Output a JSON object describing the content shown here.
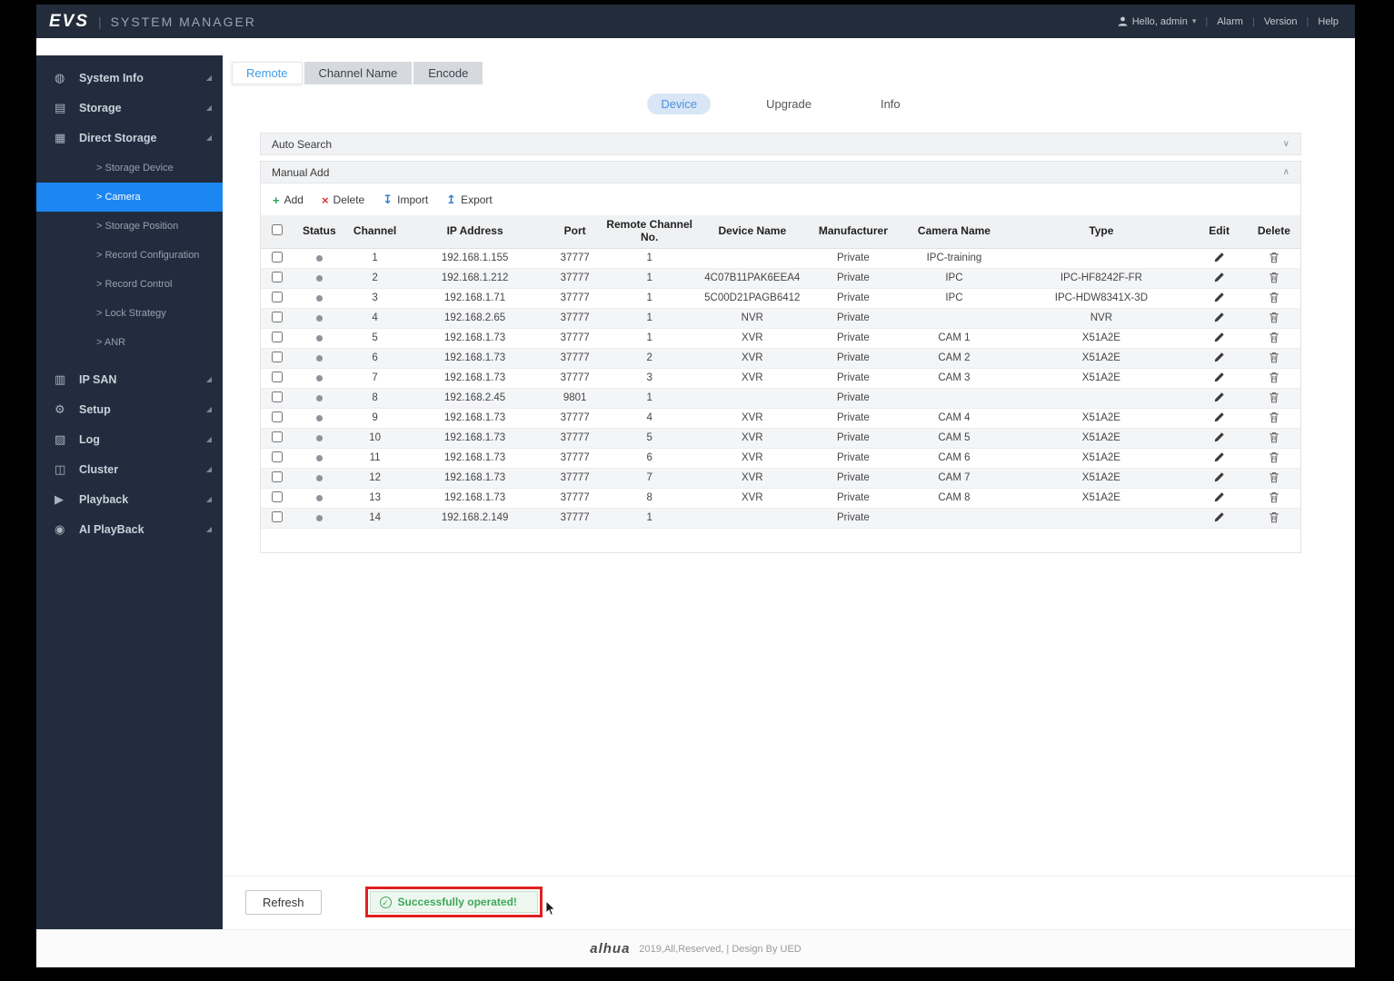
{
  "header": {
    "logo": "EVS",
    "title": "SYSTEM MANAGER",
    "user": "Hello, admin",
    "links": [
      "Alarm",
      "Version",
      "Help"
    ]
  },
  "sidebar": {
    "items": [
      {
        "label": "System Info",
        "icon": "system-info"
      },
      {
        "label": "Storage",
        "icon": "storage"
      },
      {
        "label": "Direct Storage",
        "icon": "direct-storage",
        "expanded": true,
        "children": [
          "Storage Device",
          "Camera",
          "Storage Position",
          "Record Configuration",
          "Record Control",
          "Lock Strategy",
          "ANR"
        ],
        "active_child": "Camera"
      },
      {
        "label": "IP SAN",
        "icon": "ip-san"
      },
      {
        "label": "Setup",
        "icon": "setup"
      },
      {
        "label": "Log",
        "icon": "log"
      },
      {
        "label": "Cluster",
        "icon": "cluster"
      },
      {
        "label": "Playback",
        "icon": "playback"
      },
      {
        "label": "AI PlayBack",
        "icon": "ai-playback"
      }
    ]
  },
  "tabs": {
    "items": [
      "Remote",
      "Channel Name",
      "Encode"
    ],
    "active": "Remote"
  },
  "subtabs": {
    "items": [
      "Device",
      "Upgrade",
      "Info"
    ],
    "active": "Device"
  },
  "sections": {
    "auto_search": "Auto Search",
    "manual_add": "Manual Add"
  },
  "toolbar": {
    "add": "Add",
    "delete": "Delete",
    "import": "Import",
    "export": "Export"
  },
  "table": {
    "columns": [
      "",
      "Status",
      "Channel",
      "IP Address",
      "Port",
      "Remote Channel No.",
      "Device Name",
      "Manufacturer",
      "Camera Name",
      "Type",
      "Edit",
      "Delete"
    ],
    "rows": [
      {
        "channel": "1",
        "ip": "192.168.1.155",
        "port": "37777",
        "remote_channel_no": "1",
        "device_name": "",
        "manufacturer": "Private",
        "camera_name": "IPC-training",
        "type": ""
      },
      {
        "channel": "2",
        "ip": "192.168.1.212",
        "port": "37777",
        "remote_channel_no": "1",
        "device_name": "4C07B11PAK6EEA4",
        "manufacturer": "Private",
        "camera_name": "IPC",
        "type": "IPC-HF8242F-FR"
      },
      {
        "channel": "3",
        "ip": "192.168.1.71",
        "port": "37777",
        "remote_channel_no": "1",
        "device_name": "5C00D21PAGB6412",
        "manufacturer": "Private",
        "camera_name": "IPC",
        "type": "IPC-HDW8341X-3D"
      },
      {
        "channel": "4",
        "ip": "192.168.2.65",
        "port": "37777",
        "remote_channel_no": "1",
        "device_name": "NVR",
        "manufacturer": "Private",
        "camera_name": "",
        "type": "NVR"
      },
      {
        "channel": "5",
        "ip": "192.168.1.73",
        "port": "37777",
        "remote_channel_no": "1",
        "device_name": "XVR",
        "manufacturer": "Private",
        "camera_name": "CAM 1",
        "type": "X51A2E"
      },
      {
        "channel": "6",
        "ip": "192.168.1.73",
        "port": "37777",
        "remote_channel_no": "2",
        "device_name": "XVR",
        "manufacturer": "Private",
        "camera_name": "CAM 2",
        "type": "X51A2E"
      },
      {
        "channel": "7",
        "ip": "192.168.1.73",
        "port": "37777",
        "remote_channel_no": "3",
        "device_name": "XVR",
        "manufacturer": "Private",
        "camera_name": "CAM 3",
        "type": "X51A2E"
      },
      {
        "channel": "8",
        "ip": "192.168.2.45",
        "port": "9801",
        "remote_channel_no": "1",
        "device_name": "",
        "manufacturer": "Private",
        "camera_name": "",
        "type": ""
      },
      {
        "channel": "9",
        "ip": "192.168.1.73",
        "port": "37777",
        "remote_channel_no": "4",
        "device_name": "XVR",
        "manufacturer": "Private",
        "camera_name": "CAM 4",
        "type": "X51A2E"
      },
      {
        "channel": "10",
        "ip": "192.168.1.73",
        "port": "37777",
        "remote_channel_no": "5",
        "device_name": "XVR",
        "manufacturer": "Private",
        "camera_name": "CAM 5",
        "type": "X51A2E"
      },
      {
        "channel": "11",
        "ip": "192.168.1.73",
        "port": "37777",
        "remote_channel_no": "6",
        "device_name": "XVR",
        "manufacturer": "Private",
        "camera_name": "CAM 6",
        "type": "X51A2E"
      },
      {
        "channel": "12",
        "ip": "192.168.1.73",
        "port": "37777",
        "remote_channel_no": "7",
        "device_name": "XVR",
        "manufacturer": "Private",
        "camera_name": "CAM 7",
        "type": "X51A2E"
      },
      {
        "channel": "13",
        "ip": "192.168.1.73",
        "port": "37777",
        "remote_channel_no": "8",
        "device_name": "XVR",
        "manufacturer": "Private",
        "camera_name": "CAM 8",
        "type": "X51A2E"
      },
      {
        "channel": "14",
        "ip": "192.168.2.149",
        "port": "37777",
        "remote_channel_no": "1",
        "device_name": "",
        "manufacturer": "Private",
        "camera_name": "",
        "type": ""
      }
    ]
  },
  "actions": {
    "refresh": "Refresh"
  },
  "toast": {
    "text": "Successfully operated!"
  },
  "footer": {
    "brand": "alhua",
    "text": "2019,All,Reserved, | Design By UED"
  },
  "colors": {
    "accent_blue": "#1c86f2",
    "success_green": "#3fa75a",
    "annotation_red": "#e02020",
    "sidebar_bg": "#212d3e"
  }
}
